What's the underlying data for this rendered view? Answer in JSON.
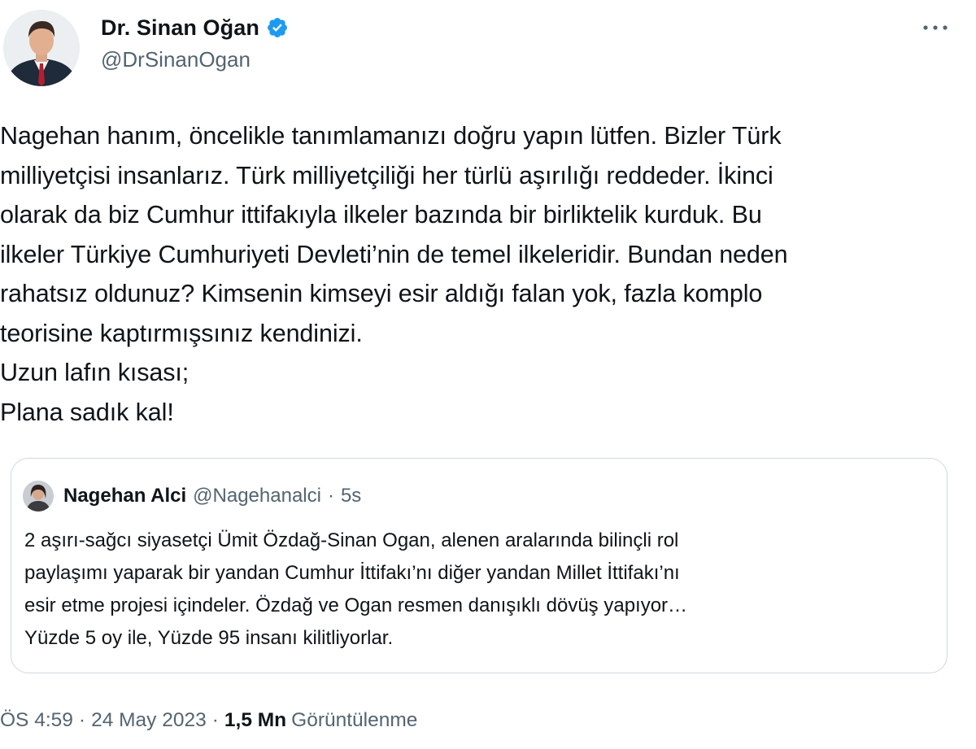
{
  "author": {
    "name": "Dr. Sinan Oğan",
    "handle": "@DrSinanOgan",
    "verified": true,
    "avatar_icon": "profile-photo-icon"
  },
  "more_icon": "ellipsis-icon",
  "tweet": {
    "text": "Nagehan hanım, öncelikle tanımlamanızı doğru yapın lütfen. Bizler Türk\nmilliyetçisi insanlarız. Türk milliyetçiliği her türlü aşırılığı reddeder. İkinci\nolarak da biz Cumhur ittifakıyla ilkeler bazında bir birliktelik kurduk. Bu\nilkeler Türkiye Cumhuriyeti Devleti’nin de temel ilkeleridir. Bundan neden\nrahatsız oldunuz?  Kimsenin kimseyi esir aldığı falan yok, fazla komplo\nteorisine kaptırmışsınız kendinizi.\nUzun lafın kısası;\nPlana sadık kal!"
  },
  "quote": {
    "name": "Nagehan Alci",
    "handle": "@Nagehanalci",
    "separator": "·",
    "time": "5s",
    "text": "2 aşırı-sağcı siyasetçi Ümit Özdağ-Sinan Ogan, alenen aralarında bilinçli rol\npaylaşımı yaparak bir yandan Cumhur İttifakı’nı diğer yandan Millet İttifakı’nı\nesir etme projesi içindeler. Özdağ ve Ogan resmen danışıklı dövüş yapıyor…\nYüzde 5 oy ile, Yüzde 95 insanı kilitliyorlar."
  },
  "meta": {
    "time": "ÖS 4:59",
    "separator": "·",
    "date": "24 May 2023",
    "views_count": "1,5 Mn",
    "views_label": "Görüntülenme"
  },
  "colors": {
    "text_primary": "#0f1419",
    "text_secondary": "#536471",
    "verified_blue": "#1d9bf0",
    "border": "#cfd9de"
  }
}
